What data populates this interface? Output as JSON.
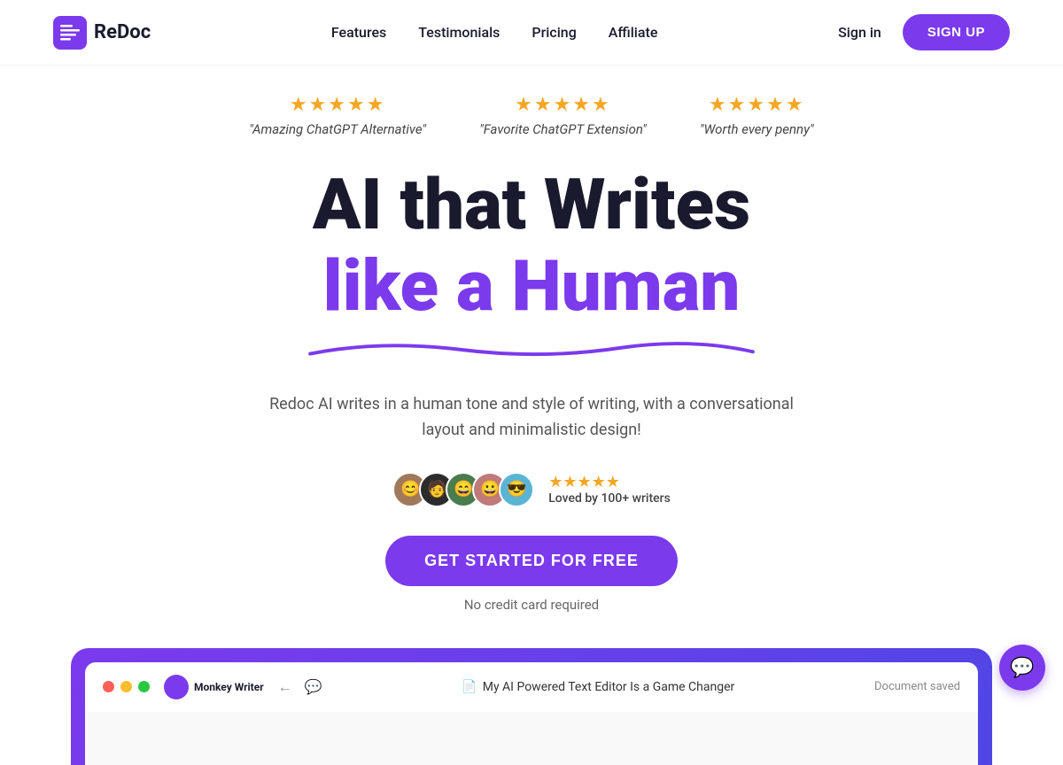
{
  "nav": {
    "logo_text": "ReDoc",
    "links": [
      {
        "label": "Features",
        "href": "#"
      },
      {
        "label": "Testimonials",
        "href": "#"
      },
      {
        "label": "Pricing",
        "href": "#"
      },
      {
        "label": "Affiliate",
        "href": "#"
      }
    ],
    "sign_in": "Sign in",
    "signup": "SIGN UP"
  },
  "reviews": [
    {
      "stars": "★★★★★",
      "text": "\"Amazing ChatGPT Alternative\""
    },
    {
      "stars": "★★★★★",
      "text": "\"Favorite ChatGPT Extension\""
    },
    {
      "stars": "★★★★★",
      "text": "\"Worth every penny\""
    }
  ],
  "hero": {
    "headline_line1": "AI that Writes",
    "headline_line2": "like a Human",
    "subtext": "Redoc AI writes in a human tone and style of writing, with a conversational layout and minimalistic design!",
    "proof_stars": "★★★★★",
    "proof_label": "Loved by 100+ writers",
    "cta_button": "GET STARTED FOR FREE",
    "no_card": "No credit card required"
  },
  "browser": {
    "app_name": "Monkey Writer",
    "chat_icon": "💬",
    "back_icon": "←",
    "comment_icon": "💬",
    "doc_icon": "📄",
    "doc_title": "My AI Powered Text Editor Is a Game Changer",
    "saved_badge": "Document saved"
  },
  "colors": {
    "purple": "#7c3aed",
    "star_gold": "#f5a623"
  }
}
